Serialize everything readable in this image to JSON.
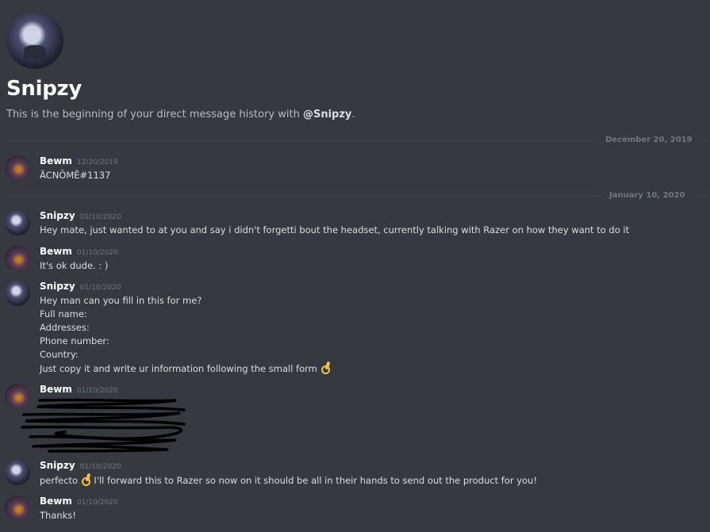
{
  "dm": {
    "name": "Snipzy",
    "intro_prefix": "This is the beginning of your direct message history with ",
    "intro_handle": "@Snipzy",
    "intro_suffix": "."
  },
  "dividers": [
    {
      "label": "December 20, 2019"
    },
    {
      "label": "January 10, 2020"
    }
  ],
  "messages": [
    {
      "author": "Bewm",
      "timestamp": "12/20/2019",
      "lines": [
        "ÃCNÕMÊ#1137"
      ]
    },
    {
      "author": "Snipzy",
      "timestamp": "01/10/2020",
      "lines": [
        "Hey mate, just wanted to at you and say i didn't forgetti bout the headset, currently talking with Razer on how they want to do it"
      ]
    },
    {
      "author": "Bewm",
      "timestamp": "01/10/2020",
      "lines": [
        "It's ok dude. : )"
      ]
    },
    {
      "author": "Snipzy",
      "timestamp": "01/10/2020",
      "lines": [
        "Hey man can you fill in this for me?",
        "Full name:",
        "Addresses:",
        "Phone number:",
        "Country:",
        "Just copy it and write ur information following the small form"
      ]
    },
    {
      "author": "Bewm",
      "timestamp": "01/10/2020",
      "lines": []
    },
    {
      "author": "Snipzy",
      "timestamp": "01/10/2020",
      "lines": [
        "perfecto",
        "I'll forward this to Razer so now on it should be all in their hands to send out the product for you!"
      ]
    },
    {
      "author": "Bewm",
      "timestamp": "01/10/2020",
      "lines": [
        "Thanks!"
      ]
    }
  ],
  "icons": {
    "ok_hand": "ok-hand-emoji-icon",
    "redaction": "scribble-redaction"
  },
  "colors": {
    "background": "#36393f",
    "text": "#dcddde",
    "muted": "#72767d",
    "divider": "#42454a",
    "emoji": "#f7c33c"
  }
}
